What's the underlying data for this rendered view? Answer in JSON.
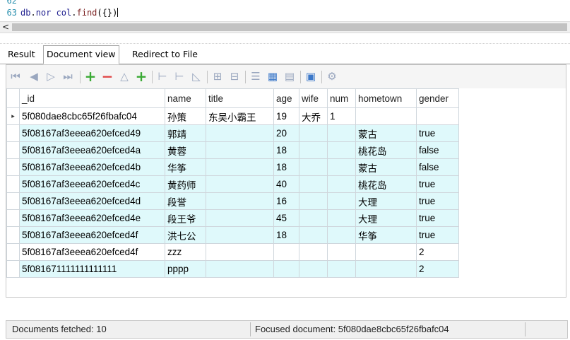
{
  "editor": {
    "line_numbers": [
      "62",
      "63"
    ],
    "line_62_code": "",
    "line_63": {
      "db": "db",
      "dot1": ".",
      "coll": "nor col",
      "dot2": ".",
      "fn": "find",
      "args": "({})"
    }
  },
  "scrollbar": {
    "left_arrow": "<"
  },
  "tabs": [
    {
      "label": "Result",
      "active": false
    },
    {
      "label": "Document view",
      "active": true
    },
    {
      "label": "Redirect to File",
      "active": false
    }
  ],
  "toolbar": {
    "icons": [
      "first-record-icon",
      "prev-record-icon",
      "next-record-icon",
      "last-record-icon",
      "add-document-icon",
      "delete-document-icon",
      "move-up-icon",
      "add-copy-icon",
      "add-field-icon",
      "remove-field-icon",
      "edit-field-icon",
      "expand-icon",
      "collapse-icon",
      "text-view-icon",
      "grid-view-icon",
      "form-view-icon",
      "export-icon",
      "settings-icon"
    ]
  },
  "grid": {
    "columns": [
      "_id",
      "name",
      "title",
      "age",
      "wife",
      "num",
      "hometown",
      "gender"
    ],
    "rows": [
      {
        "indicator": "▸",
        "cells": [
          "5f080dae8cbc65f26fbafc04",
          "孙策",
          "东吴小霸王",
          "19",
          "大乔",
          "1",
          "",
          ""
        ]
      },
      {
        "indicator": "",
        "cells": [
          "5f08167af3eeea620efced49",
          "郭靖",
          "",
          "20",
          "",
          "",
          "蒙古",
          "true"
        ]
      },
      {
        "indicator": "",
        "cells": [
          "5f08167af3eeea620efced4a",
          "黄蓉",
          "",
          "18",
          "",
          "",
          "桃花岛",
          "false"
        ]
      },
      {
        "indicator": "",
        "cells": [
          "5f08167af3eeea620efced4b",
          "华筝",
          "",
          "18",
          "",
          "",
          "蒙古",
          "false"
        ]
      },
      {
        "indicator": "",
        "cells": [
          "5f08167af3eeea620efced4c",
          "黄药师",
          "",
          "40",
          "",
          "",
          "桃花岛",
          "true"
        ]
      },
      {
        "indicator": "",
        "cells": [
          "5f08167af3eeea620efced4d",
          "段誉",
          "",
          "16",
          "",
          "",
          "大理",
          "true"
        ]
      },
      {
        "indicator": "",
        "cells": [
          "5f08167af3eeea620efced4e",
          "段王爷",
          "",
          "45",
          "",
          "",
          "大理",
          "true"
        ]
      },
      {
        "indicator": "",
        "cells": [
          "5f08167af3eeea620efced4f",
          "洪七公",
          "",
          "18",
          "",
          "",
          "华筝",
          "true"
        ]
      },
      {
        "indicator": "",
        "cells": [
          "5f08167af3eeea620efced4f",
          "zzz",
          "",
          "",
          "",
          "",
          "",
          "2"
        ]
      },
      {
        "indicator": "",
        "cells": [
          "5f081671111111111111",
          "pppp",
          "",
          "",
          "",
          "",
          "",
          "2"
        ]
      }
    ]
  },
  "status": {
    "fetched": "Documents fetched: 10",
    "focused": "Focused document: 5f080dae8cbc65f26fbafc04"
  },
  "colors": {
    "alt_row": "#dff9fb",
    "grid_border": "#cfd6dc",
    "toolbar_bg": "#f5f5f5"
  }
}
